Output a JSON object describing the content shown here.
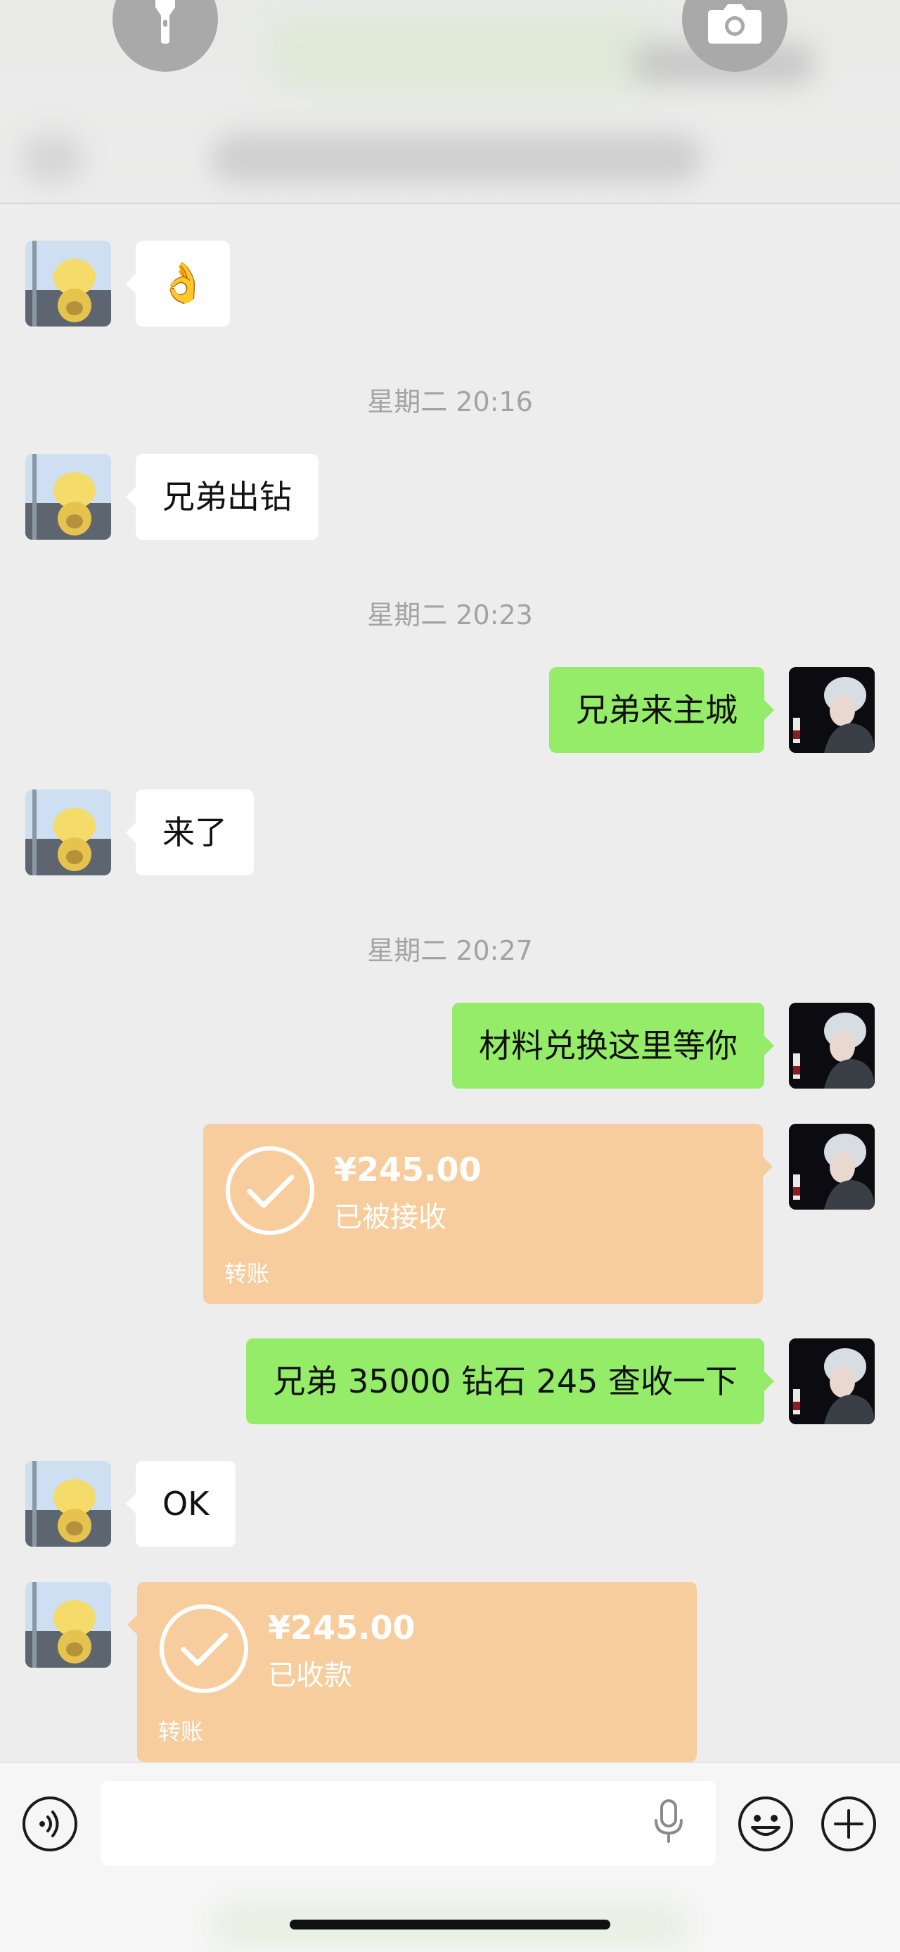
{
  "chat": {
    "messages": [
      {
        "type": "emoji",
        "side": "in",
        "text": "👌"
      },
      {
        "type": "time",
        "text": "星期二 20:16"
      },
      {
        "type": "text",
        "side": "in",
        "text": "兄弟出钻"
      },
      {
        "type": "time",
        "text": "星期二 20:23"
      },
      {
        "type": "text",
        "side": "out",
        "text": "兄弟来主城"
      },
      {
        "type": "text",
        "side": "in",
        "text": "来了"
      },
      {
        "type": "time",
        "text": "星期二 20:27"
      },
      {
        "type": "text",
        "side": "out",
        "text": "材料兑换这里等你"
      },
      {
        "type": "transfer",
        "side": "out",
        "amount": "¥245.00",
        "status": "已被接收",
        "label": "转账"
      },
      {
        "type": "text",
        "side": "out",
        "text": "兄弟 35000 钻石 245 查收一下"
      },
      {
        "type": "text",
        "side": "in",
        "text": "OK"
      },
      {
        "type": "transfer",
        "side": "in",
        "amount": "¥245.00",
        "status": "已收款",
        "label": "转账"
      }
    ]
  },
  "input_bar": {
    "voice_icon": "voice-icon",
    "mic_icon": "microphone-icon",
    "emoji_icon": "emoji-icon",
    "plus_icon": "plus-icon"
  },
  "overlay": {
    "left_icon": "flashlight-icon",
    "right_icon": "camera-icon"
  },
  "colors": {
    "background": "#ededed",
    "outgoing_bubble": "#95ec69",
    "incoming_bubble": "#ffffff",
    "transfer_card": "#f8cd9e",
    "timestamp": "#a3a3a3"
  }
}
